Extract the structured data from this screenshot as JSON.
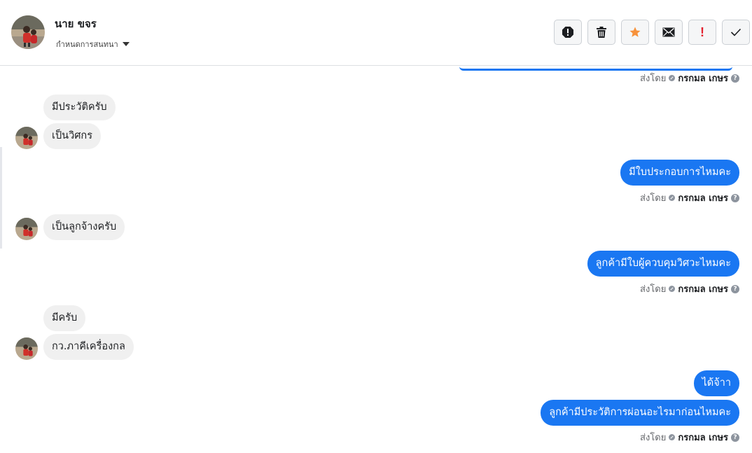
{
  "contact": {
    "name": "นาย ขจร",
    "assign_label": "กำหนดการสนทนา"
  },
  "toolbar": {
    "buttons": [
      {
        "name": "report-spam-button",
        "icon": "alert-octagon-icon"
      },
      {
        "name": "delete-button",
        "icon": "trash-icon"
      },
      {
        "name": "star-button",
        "icon": "star-icon"
      },
      {
        "name": "mark-unread-button",
        "icon": "envelope-icon"
      },
      {
        "name": "mark-important-button",
        "icon": "exclamation-icon",
        "glyph": "!"
      },
      {
        "name": "mark-done-button",
        "icon": "check-icon"
      }
    ]
  },
  "sent_by": {
    "prefix": "ส่งโดย",
    "agent": "กรกมล เกษร",
    "help": "?"
  },
  "messages": {
    "m1": "มีประวัติครับ",
    "m2": "เป็นวิศกร",
    "m3": "มีใบประกอบการไหมคะ",
    "m4": "เป็นลูกจ้างครับ",
    "m5": "ลูกค้ามีใบผู้ควบคุมวิศวะไหมคะ",
    "m6": "มีครับ",
    "m7": "กว.ภาคีเครื่องกล",
    "m8": "ได้จ้าา",
    "m9": "ลูกค้ามีประวัติการผ่อนอะไรมาก่อนไหมคะ"
  },
  "colors": {
    "outgoing_bubble": "#1a77f2",
    "incoming_bubble": "#f0f0f0",
    "star": "#f7923b",
    "important": "#e4202e"
  }
}
